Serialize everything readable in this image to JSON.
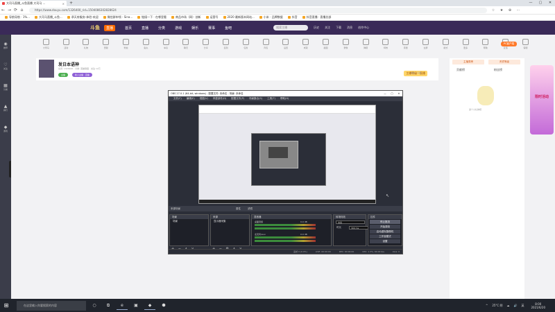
{
  "browser": {
    "tab_title": "大司马直播_斗鱼直播 大司马 ...",
    "tab_close": "×",
    "new_tab": "+",
    "url": "https://www.douyu.com/1326400_rid=1504086302828624",
    "nav": {
      "back": "←",
      "forward": "→",
      "reload": "⟳",
      "home": "⌂"
    },
    "right_icons": [
      "☆",
      "★",
      "⊕",
      "⋯"
    ]
  },
  "bookmarks": [
    "导航导航 · 1%...",
    "大司马直播_斗鱼...",
    "承天府服务-体验-欢迎",
    "微信群申领 - Sina...",
    "链接一下 · 在哪里看",
    "商品市场（网）· 创新",
    "运营号",
    "2020 最新版本网站...",
    "小米 · 品牌数据",
    "抖音",
    "抖音直播 · 直播总部"
  ],
  "site": {
    "logo": "斗鱼",
    "live_badge": "直播",
    "nav": [
      "首页",
      "直播",
      "分类",
      "游戏",
      "娱乐",
      "赛事"
    ],
    "nav_more": "鱼吧",
    "search_placeholder": "搜索主播",
    "header_icons": [
      "历史",
      "关注",
      "下载",
      "消息",
      "创作中心"
    ]
  },
  "left_sidebar": [
    "推荐",
    "关注",
    "分类",
    "排行",
    "游戏"
  ],
  "toolbar_items": [
    "大司马",
    "活动",
    "礼物",
    "贡献",
    "粉丝",
    "鱼丸",
    "车队",
    "聊天",
    "分享",
    "签到",
    "任务",
    "背包",
    "设置",
    "成就",
    "截图",
    "录像",
    "弹幕",
    "特效",
    "音量",
    "全屏",
    "模式",
    "更多",
    "帮助",
    "反馈",
    "客服"
  ],
  "streamer": {
    "name": "发日本语神",
    "meta": "房间: 1326400 · 分类: 英雄联盟 · 关注 12万",
    "tag1": "主播",
    "tag2": "新人主播 · 直播",
    "ranking": "主播等级 · 直播",
    "follow": "关注 · 订阅"
  },
  "right_panel": {
    "btn_left": "主播周榜",
    "btn_right": "贵宾等级",
    "tab_left": "贡献榜",
    "tab_right": "粉丝榜",
    "sticker_caption": "送个小礼物吧"
  },
  "pc_badge": "PC客户端",
  "ad": {
    "title": "限时活动"
  },
  "obs": {
    "title": "OBS 27.0.1 (64-bit, windows) - 配置文件: 未命名 - 场景: 未命名",
    "menu": [
      "文件(F)",
      "编辑(E)",
      "视图(V)",
      "停靠部件(D)",
      "配置文件(P)",
      "场景集合(S)",
      "工具(T)",
      "帮助(H)"
    ],
    "scene_header": "来源场景",
    "props_label": "属性",
    "filters_label": "滤镜",
    "scenes": {
      "title": "场景",
      "items": [
        "场景"
      ]
    },
    "sources": {
      "title": "来源",
      "items": [
        "显示器采集"
      ]
    },
    "mixer": {
      "title": "混音器",
      "channels": [
        {
          "name": "桌面音频",
          "level": "0.0 dB"
        },
        {
          "name": "麦克风/Aux",
          "level": "0.0 dB"
        }
      ]
    },
    "transitions": {
      "title": "转场特效",
      "selected": "淡出",
      "duration_label": "时长",
      "duration": "300 ms"
    },
    "controls": {
      "title": "控件",
      "buttons": [
        "停止推流",
        "开始录制",
        "启动虚拟摄像机",
        "工作室模式",
        "设置",
        "退出"
      ]
    },
    "dock_ops": "+ − ∧ ∨",
    "dock_ops_src": "+ − ⚙ ∧ ∨",
    "status": {
      "dropped": "丢帧 0 (0.0%)",
      "live": "LIVE: 00:00:00",
      "rec": "REC: 00:00:00",
      "cpu": "CPU: 1.3%, 60.00 fps",
      "kbps": "kb/s: 0"
    }
  },
  "taskbar": {
    "start": "⊞",
    "search": "在这里输入你要搜索的内容",
    "apps": [
      "○",
      "⧉",
      "e",
      "▣",
      "◆",
      "⬢"
    ],
    "tray": [
      "^",
      "☁",
      "🔊"
    ],
    "weather": "25°C 阴",
    "ime": "英",
    "time": "8:00",
    "date": "2021/6/20"
  }
}
